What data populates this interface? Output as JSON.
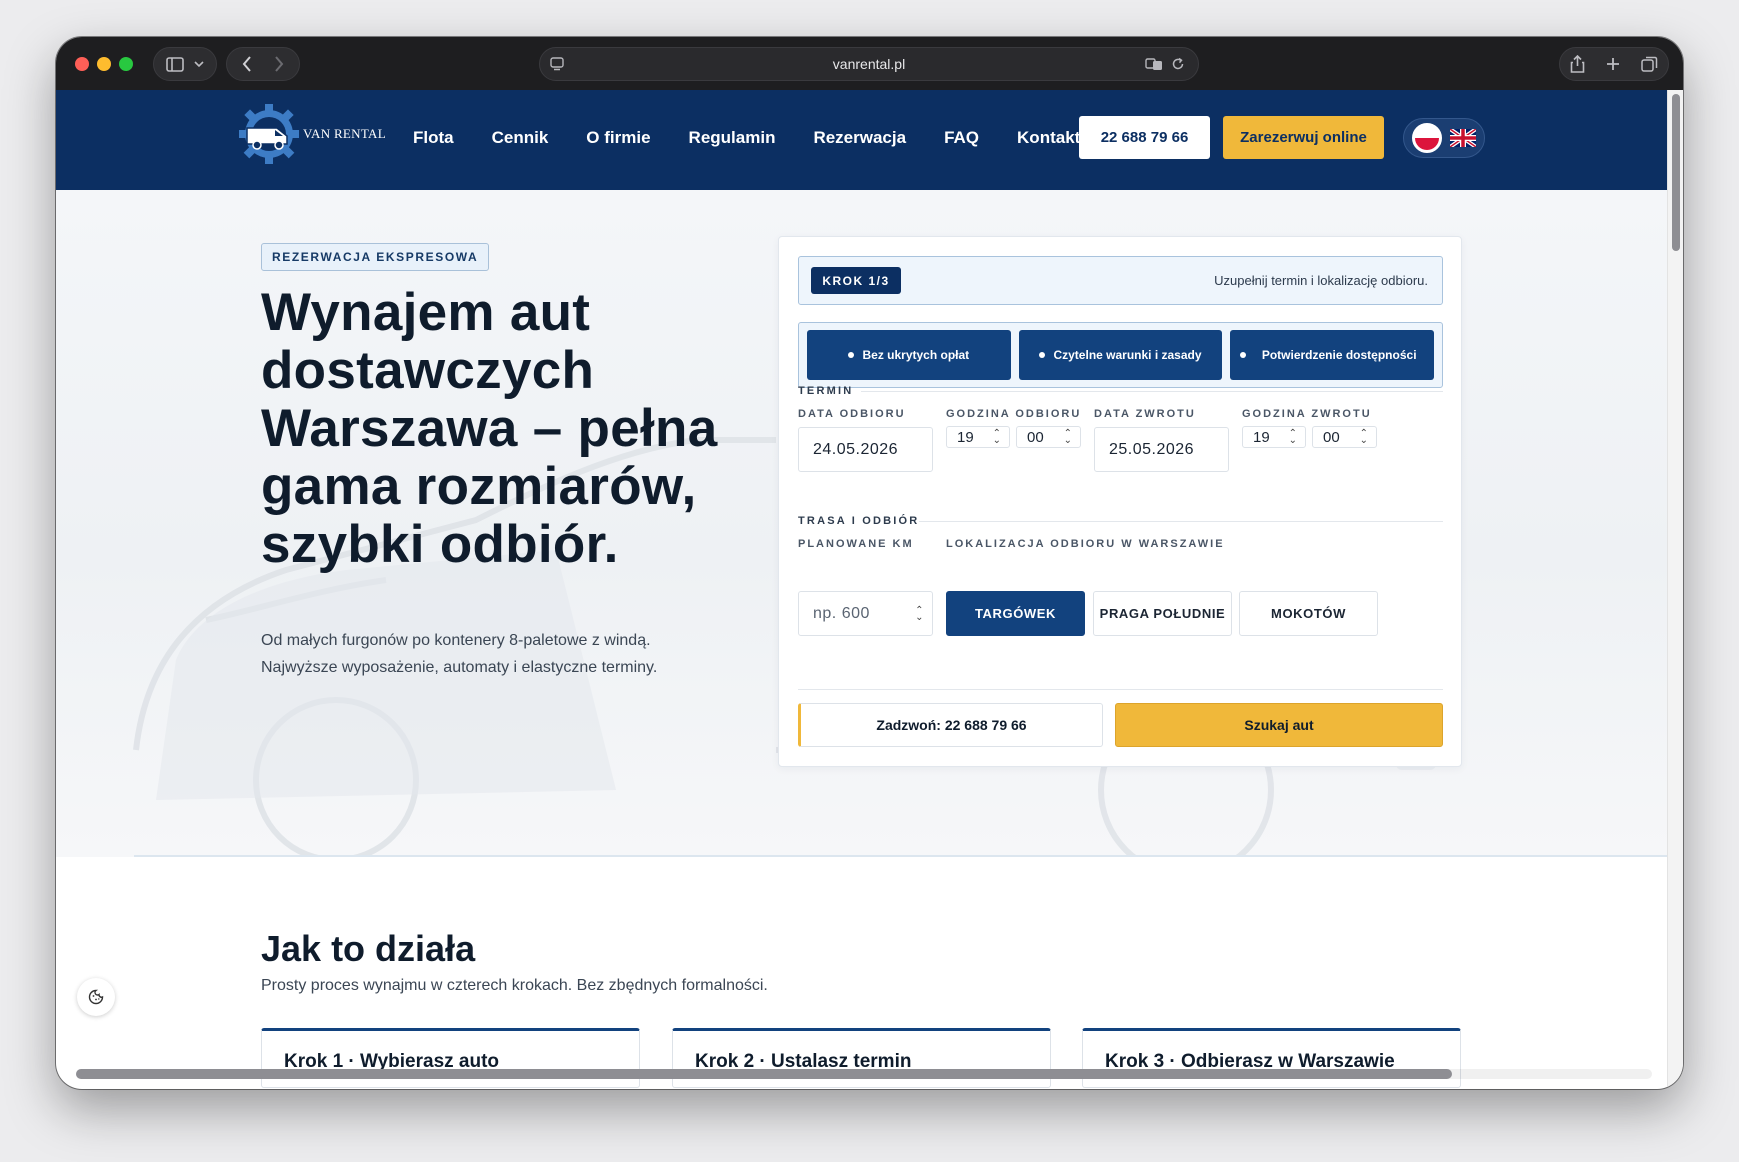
{
  "browser": {
    "url": "vanrental.pl"
  },
  "header": {
    "logo_text": "VAN RENTAL",
    "nav": [
      "Flota",
      "Cennik",
      "O firmie",
      "Regulamin",
      "Rezerwacja",
      "FAQ",
      "Kontakt"
    ],
    "phone": "22 688 79 66",
    "cta": "Zarezerwuj online",
    "languages": [
      "pl-flag",
      "gb-flag"
    ]
  },
  "hero": {
    "badge": "REZERWACJA EKSPRESOWA",
    "title": "Wynajem aut dostawczych Warszawa – pełna gama rozmiarów, szybki odbiór.",
    "subtitle_line1": "Od małych furgonów po kontenery 8-paletowe z windą.",
    "subtitle_line2": "Najwyższe wyposażenie, automaty i elastyczne terminy."
  },
  "booking": {
    "step": "KROK 1/3",
    "step_hint": "Uzupełnij termin i lokalizację odbioru.",
    "features": [
      "Bez ukrytych opłat",
      "Czytelne warunki i zasady",
      "Potwierdzenie dostępności"
    ],
    "term_label": "TERMIN",
    "pickup_date_label": "DATA ODBIORU",
    "pickup_date": "24.05.2026",
    "pickup_hour_label": "GODZINA ODBIORU",
    "pickup_hour": "19",
    "pickup_minute": "00",
    "return_date_label": "DATA ZWROTU",
    "return_date": "25.05.2026",
    "return_hour_label": "GODZINA ZWROTU",
    "return_hour": "19",
    "return_minute": "00",
    "route_label": "TRASA I ODBIÓR",
    "km_label": "PLANOWANE KM",
    "km_placeholder": "np. 600",
    "location_label": "LOKALIZACJA ODBIORU W WARSZAWIE",
    "locations": [
      "TARGÓWEK",
      "PRAGA POŁUDNIE",
      "MOKOTÓW"
    ],
    "selected_location": "TARGÓWEK",
    "call_button": "Zadzwoń: 22 688 79 66",
    "search_button": "Szukaj aut"
  },
  "how": {
    "title": "Jak to działa",
    "subtitle": "Prosty proces wynajmu w czterech krokach. Bez zbędnych formalności.",
    "steps": [
      "Krok 1 · Wybierasz auto",
      "Krok 2 · Ustalasz termin",
      "Krok 3 · Odbierasz w Warszawie"
    ]
  },
  "colors": {
    "navy": "#0c2f62",
    "button_blue": "#12427e",
    "accent_yellow": "#f0b83a"
  }
}
